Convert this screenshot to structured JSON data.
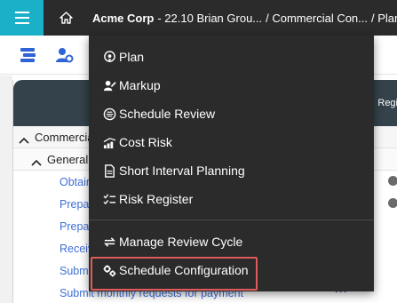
{
  "topbar": {
    "hamburger_icon": "hamburger-icon",
    "home_icon": "home-icon",
    "breadcrumb": {
      "org": "Acme Corp",
      "project": "- 22.10 Brian Grou...",
      "area": "/ Commercial Con...",
      "current": "/ Plan"
    }
  },
  "toolbar": {
    "icons": [
      "list-view-icon",
      "resource-settings-icon"
    ]
  },
  "background": {
    "panel_header_text": "Regi",
    "tree": [
      {
        "label": "Commercial"
      },
      {
        "label": "General C"
      }
    ],
    "tasks": [
      "Obtain",
      "Prepar",
      "Prepar",
      "Receiv",
      "Submit",
      "Submit monthly requests for payment"
    ],
    "more": "•••"
  },
  "menu": {
    "items": [
      {
        "label": "Plan",
        "icon": "map-pin-icon"
      },
      {
        "label": "Markup",
        "icon": "markup-icon"
      },
      {
        "label": "Schedule Review",
        "icon": "schedule-review-icon"
      },
      {
        "label": "Cost Risk",
        "icon": "cost-risk-icon"
      },
      {
        "label": "Short Interval Planning",
        "icon": "document-icon"
      },
      {
        "label": "Risk Register",
        "icon": "checklist-icon"
      },
      {
        "label": "Manage Review Cycle",
        "icon": "review-cycle-icon"
      },
      {
        "label": "Schedule Configuration",
        "icon": "gears-icon"
      }
    ],
    "selected_index": 7
  },
  "colors": {
    "accent": "#1ab0c8",
    "topbar": "#2b2b2b",
    "menu_bg": "#2b2b2b",
    "highlight_border": "#e05a5a",
    "link": "#3f6fd8",
    "panel_header": "#34424c"
  }
}
